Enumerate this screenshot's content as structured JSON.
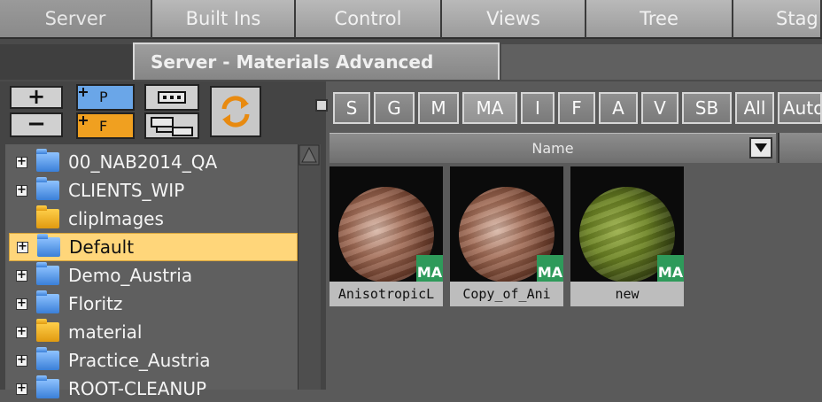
{
  "top_tabs": [
    "Server",
    "Built Ins",
    "Control",
    "Views",
    "Tree",
    "Stag"
  ],
  "active_top_tab": "Server",
  "title": "Server - Materials Advanced",
  "toolbar": {
    "plus": "+",
    "minus": "−",
    "p_label": "P",
    "f_label": "F"
  },
  "tree": {
    "items": [
      {
        "label": "00_NAB2014_QA",
        "folder": "blue",
        "expander": "+"
      },
      {
        "label": "CLIENTS_WIP",
        "folder": "blue",
        "expander": "+"
      },
      {
        "label": "clipImages",
        "folder": "orange",
        "expander": ""
      },
      {
        "label": "Default",
        "folder": "blue",
        "expander": "+",
        "selected": true
      },
      {
        "label": "Demo_Austria",
        "folder": "blue",
        "expander": "+"
      },
      {
        "label": "Floritz",
        "folder": "blue",
        "expander": "+"
      },
      {
        "label": "material",
        "folder": "orange",
        "expander": "+"
      },
      {
        "label": "Practice_Austria",
        "folder": "blue",
        "expander": "+"
      },
      {
        "label": "ROOT-CLEANUP",
        "folder": "blue",
        "expander": "+"
      }
    ]
  },
  "filters": [
    "S",
    "G",
    "M",
    "MA",
    "I",
    "F",
    "A",
    "V",
    "SB",
    "All",
    "Auto"
  ],
  "active_filter": "MA",
  "column_header": "Name",
  "materials": [
    {
      "name": "AnisotropicL",
      "badge": "MA",
      "style": "brown"
    },
    {
      "name": "Copy_of_Ani",
      "badge": "MA",
      "style": "brown"
    },
    {
      "name": "new",
      "badge": "MA",
      "style": "green"
    }
  ],
  "colors": {
    "selected_row": "#ffd67a",
    "badge": "#2e9a5a",
    "folder_blue": "#4a8fe0",
    "folder_orange": "#f0a020"
  }
}
